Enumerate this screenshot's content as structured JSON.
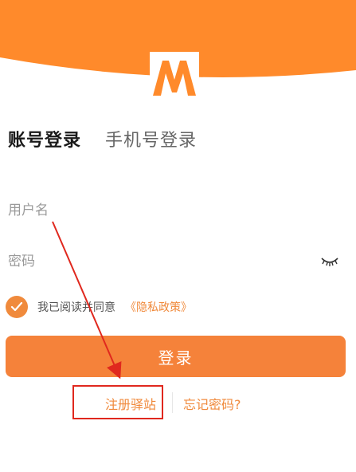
{
  "header": {
    "bg_color": "#ff8a2b",
    "logo_letter": "M",
    "logo_color": "#ff8a2b"
  },
  "tabs": {
    "account_login": "账号登录",
    "phone_login": "手机号登录"
  },
  "form": {
    "username_placeholder": "用户名",
    "password_placeholder": "密码",
    "eye_icon": "eye-closed-icon"
  },
  "agreement": {
    "checked": true,
    "text": "我已阅读并同意",
    "privacy_link": "《隐私政策》"
  },
  "login_button": "登录",
  "links": {
    "register": "注册驿站",
    "forgot_password": "忘记密码?"
  },
  "colors": {
    "accent": "#f5823a",
    "annotation_red": "#e0281e"
  }
}
